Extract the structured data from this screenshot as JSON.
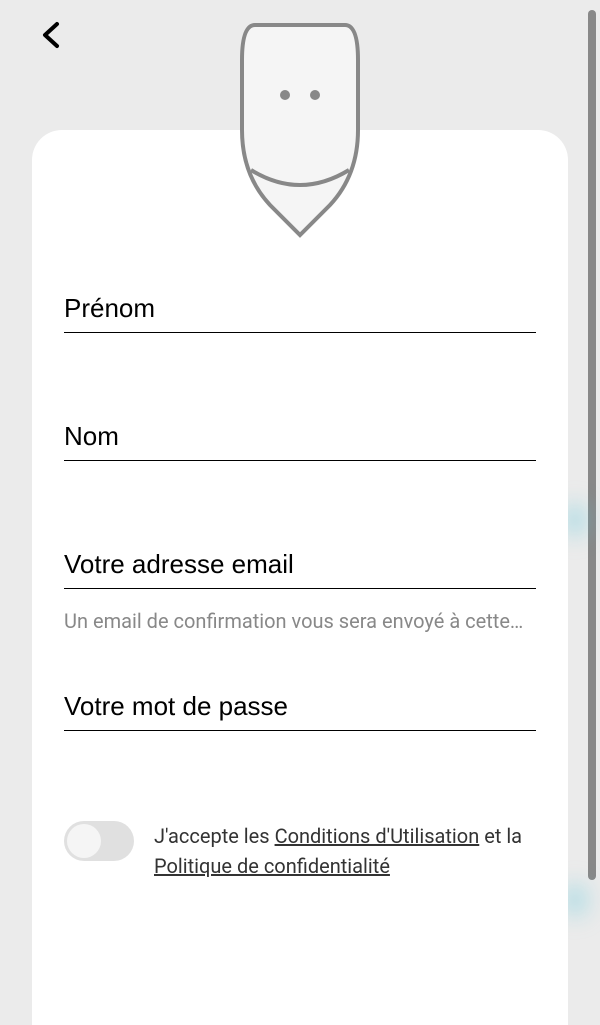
{
  "form": {
    "firstName": {
      "placeholder": "Prénom",
      "value": ""
    },
    "lastName": {
      "placeholder": "Nom",
      "value": ""
    },
    "email": {
      "placeholder": "Votre adresse email",
      "value": "",
      "helper": "Un email de confirmation vous sera envoyé à cette…"
    },
    "password": {
      "placeholder": "Votre mot de passe",
      "value": ""
    }
  },
  "terms": {
    "intro": "J'accepte les ",
    "link1": "Conditions d'Utilisation",
    "middle": " et la ",
    "link2": "Politique de confidentialité"
  }
}
